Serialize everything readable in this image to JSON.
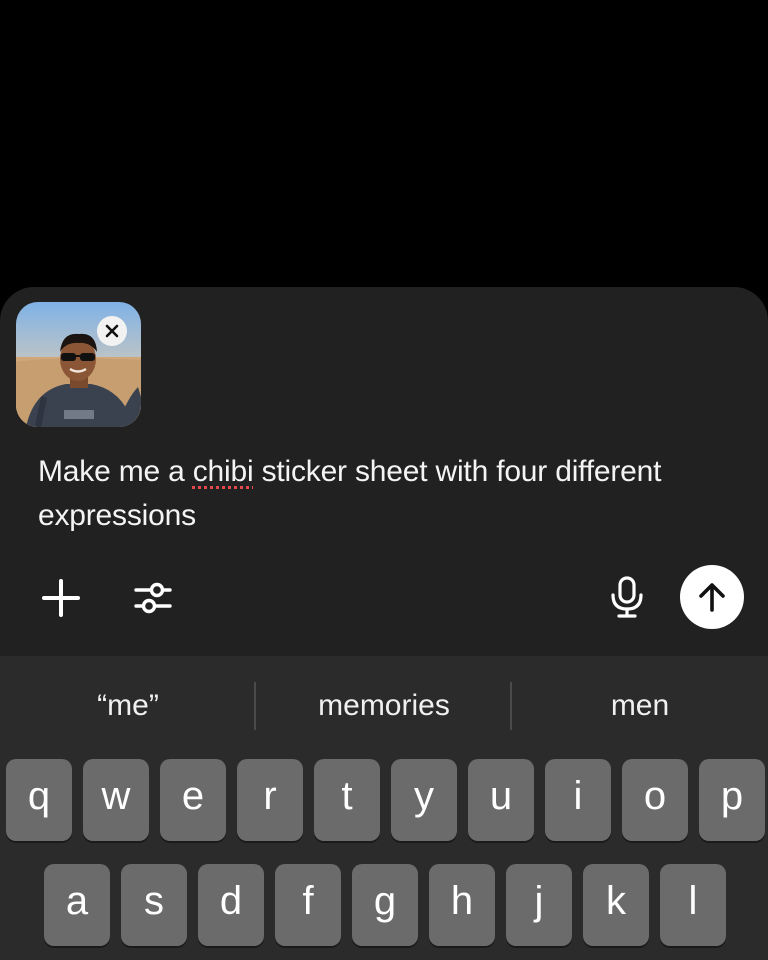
{
  "attachment": {
    "alt": "selfie photo attachment",
    "remove_label": "×"
  },
  "prompt": {
    "before": "Make me a ",
    "misspelled_word": "chibi",
    "after": " sticker sheet with four different expressions"
  },
  "toolbar": {
    "add_icon": "plus-icon",
    "tools_icon": "sliders-icon",
    "mic_icon": "microphone-icon",
    "send_icon": "arrow-up-icon"
  },
  "keyboard": {
    "suggestions": [
      "“me”",
      "memories",
      "men"
    ],
    "row1": [
      "q",
      "w",
      "e",
      "r",
      "t",
      "y",
      "u",
      "i",
      "o",
      "p"
    ],
    "row2": [
      "a",
      "s",
      "d",
      "f",
      "g",
      "h",
      "j",
      "k",
      "l"
    ]
  },
  "colors": {
    "background": "#000000",
    "composer": "#212121",
    "keyboard": "#2b2b2b",
    "key": "#6b6b6b",
    "text": "#f4f4f4",
    "spellcheck": "#e5484d"
  }
}
